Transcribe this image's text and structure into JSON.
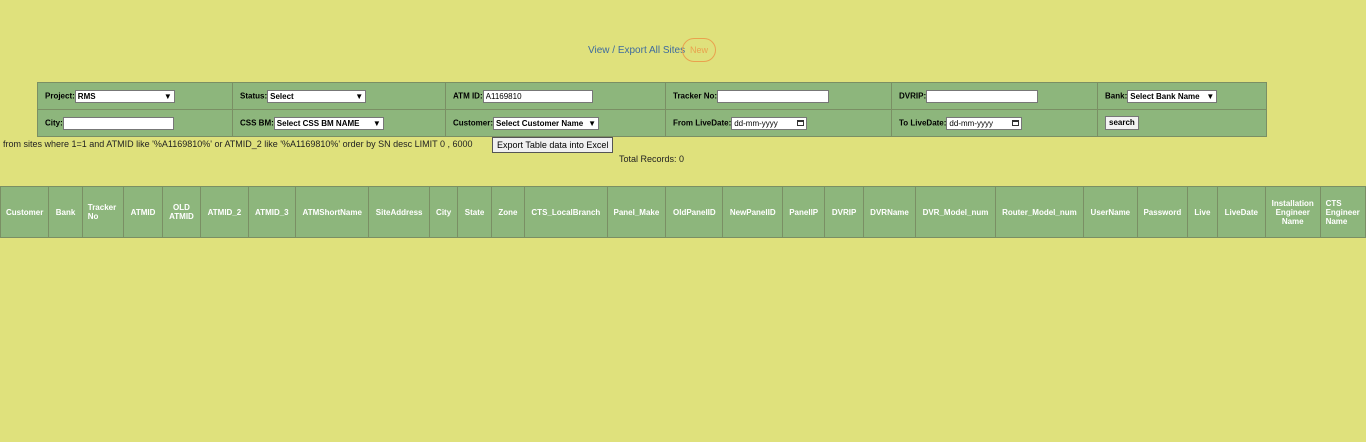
{
  "top_links": {
    "view_export": "View / Export All Sites",
    "new_badge": "New"
  },
  "filters": {
    "project": {
      "label": "Project:",
      "value": "RMS"
    },
    "status": {
      "label": "Status:",
      "value": "Select"
    },
    "atm_id": {
      "label": "ATM ID:",
      "value": "A1169810"
    },
    "tracker_no": {
      "label": "Tracker No:",
      "value": ""
    },
    "dvrip": {
      "label": "DVRIP:",
      "value": ""
    },
    "bank": {
      "label": "Bank:",
      "value": "Select Bank Name"
    },
    "city": {
      "label": "City:",
      "value": ""
    },
    "css_bm": {
      "label": "CSS BM:",
      "value": "Select CSS BM NAME"
    },
    "customer": {
      "label": "Customer:",
      "value": "Select Customer Name"
    },
    "from_live_date": {
      "label": "From LiveDate:",
      "value": "dd-mm-yyyy"
    },
    "to_live_date": {
      "label": "To LiveDate:",
      "value": "dd-mm-yyyy"
    },
    "search_label": "search"
  },
  "query_text": "from sites where 1=1 and ATMID like '%A1169810%' or ATMID_2 like '%A1169810%' order by SN desc LIMIT 0 , 6000",
  "export_label": "Export Table data into Excel",
  "total_records": "Total Records: 0",
  "results_table": {
    "columns": [
      "Customer",
      "Bank",
      "Tracker No",
      "ATMID",
      "OLD ATMID",
      "ATMID_2",
      "ATMID_3",
      "ATMShortName",
      "SiteAddress",
      "City",
      "State",
      "Zone",
      "CTS_LocalBranch",
      "Panel_Make",
      "OldPanelID",
      "NewPanelID",
      "PanelIP",
      "DVRIP",
      "DVRName",
      "DVR_Model_num",
      "Router_Model_num",
      "UserName",
      "Password",
      "Live",
      "LiveDate",
      "Installation Engineer Name",
      "CTS Engineer Name"
    ]
  }
}
